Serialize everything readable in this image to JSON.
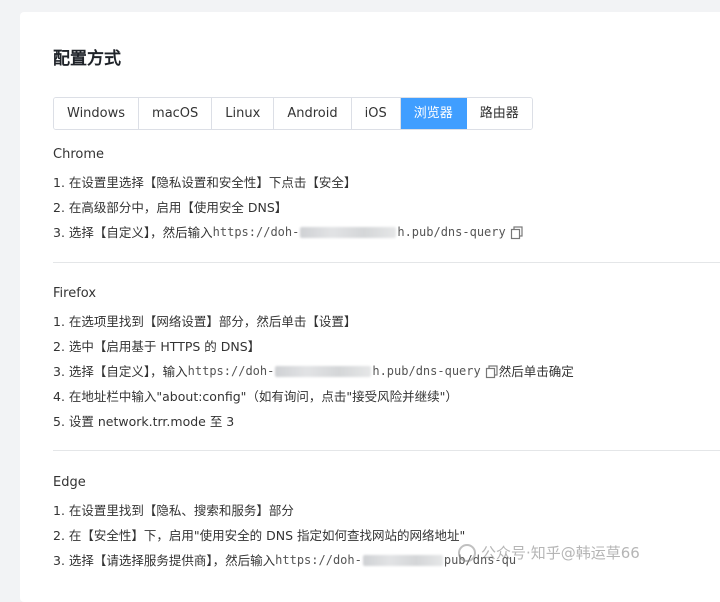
{
  "title": "配置方式",
  "tabs": [
    {
      "label": "Windows",
      "active": false
    },
    {
      "label": "macOS",
      "active": false
    },
    {
      "label": "Linux",
      "active": false
    },
    {
      "label": "Android",
      "active": false
    },
    {
      "label": "iOS",
      "active": false
    },
    {
      "label": "浏览器",
      "active": true
    },
    {
      "label": "路由器",
      "active": false
    }
  ],
  "accent_color": "#409eff",
  "chrome": {
    "name": "Chrome",
    "step1": "1. 在设置里选择【隐私设置和安全性】下点击【安全】",
    "step2": "2. 在高级部分中，启用【使用安全 DNS】",
    "step3_prefix": "3. 选择【自定义】，然后输入 ",
    "url_start": "https://doh-",
    "url_end": "h.pub/dns-query"
  },
  "firefox": {
    "name": "Firefox",
    "step1": "1. 在选项里找到【网络设置】部分，然后单击【设置】",
    "step2": "2. 选中【启用基于 HTTPS 的 DNS】",
    "step3_prefix": "3. 选择【自定义】，输入 ",
    "url_start": "https://doh-",
    "url_end": "h.pub/dns-query",
    "step3_suffix": " 然后单击确定",
    "step4": "4. 在地址栏中输入\"about:config\"（如有询问，点击\"接受风险并继续\"）",
    "step5": "5. 设置 network.trr.mode 至 3"
  },
  "edge": {
    "name": "Edge",
    "step1": "1. 在设置里找到【隐私、搜索和服务】部分",
    "step2": "2. 在【安全性】下，启用\"使用安全的 DNS 指定如何查找网站的网络地址\"",
    "step3_prefix": "3. 选择【请选择服务提供商】，然后输入 ",
    "url_start": "https://doh-",
    "url_end": "pub/dns-qu"
  },
  "watermark": "公众号·知乎@韩运草66"
}
